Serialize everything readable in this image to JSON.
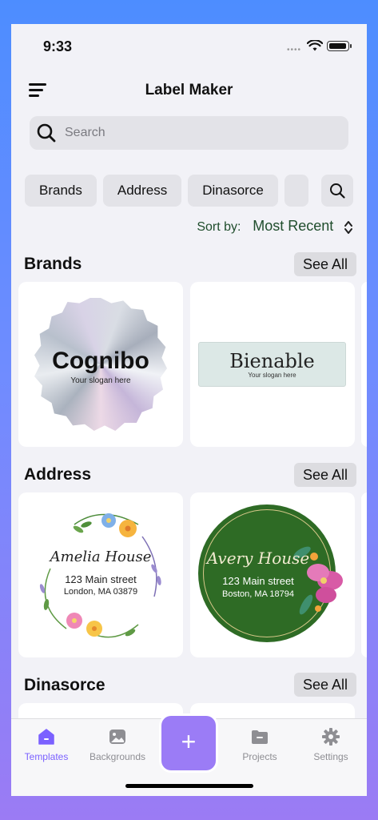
{
  "status_bar": {
    "time": "9:33"
  },
  "header": {
    "title": "Label Maker"
  },
  "search": {
    "placeholder": "Search"
  },
  "chips": [
    "Brands",
    "Address",
    "Dinasorce"
  ],
  "sort": {
    "label": "Sort by:",
    "value": "Most Recent"
  },
  "see_all": "See All",
  "sections": {
    "brands": {
      "title": "Brands",
      "cards": [
        {
          "name": "Cognibo",
          "slogan": "Your slogan here"
        },
        {
          "name": "Bienable",
          "slogan": "Your slogan here"
        }
      ]
    },
    "address": {
      "title": "Address",
      "cards": [
        {
          "name": "Amelia House",
          "street": "123 Main street",
          "city": "London, MA 03879"
        },
        {
          "name": "Avery House",
          "street": "123 Main street",
          "city": "Boston, MA 18794"
        }
      ]
    },
    "dinasorce": {
      "title": "Dinasorce"
    }
  },
  "tabbar": {
    "items": [
      "Templates",
      "Backgrounds",
      "Projects",
      "Settings"
    ],
    "add_symbol": "+"
  },
  "colors": {
    "accent": "#7b61ff",
    "fab": "#9b7cf6",
    "sort_text": "#1f4d2c",
    "address_green": "#2e6b25"
  },
  "icons": [
    "menu-icon",
    "search-icon",
    "chevron-up-down-icon",
    "home-icon",
    "image-icon",
    "plus-icon",
    "folder-icon",
    "gear-icon",
    "wifi-icon",
    "battery-icon"
  ]
}
